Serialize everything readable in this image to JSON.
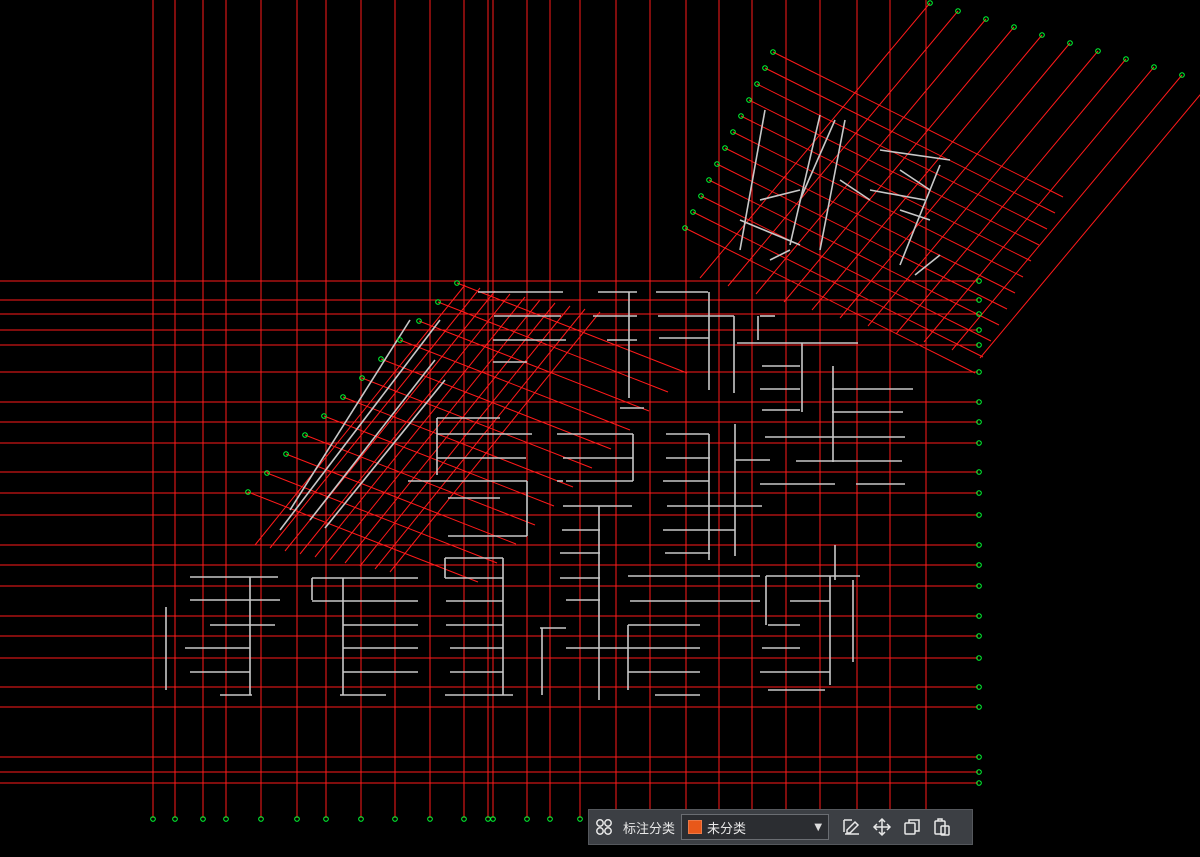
{
  "colors": {
    "background": "#000000",
    "grid": "#ff1a1a",
    "walls": "#c8c8c8",
    "nodes": "#00ff33",
    "highlight": "#ffff44",
    "category": "#e8581a"
  },
  "toolbar": {
    "category_label": "标注分类",
    "category_value": "未分类",
    "buttons": [
      "group-icon",
      "edit-icon",
      "move-icon",
      "copy-icon",
      "paste-icon"
    ]
  }
}
